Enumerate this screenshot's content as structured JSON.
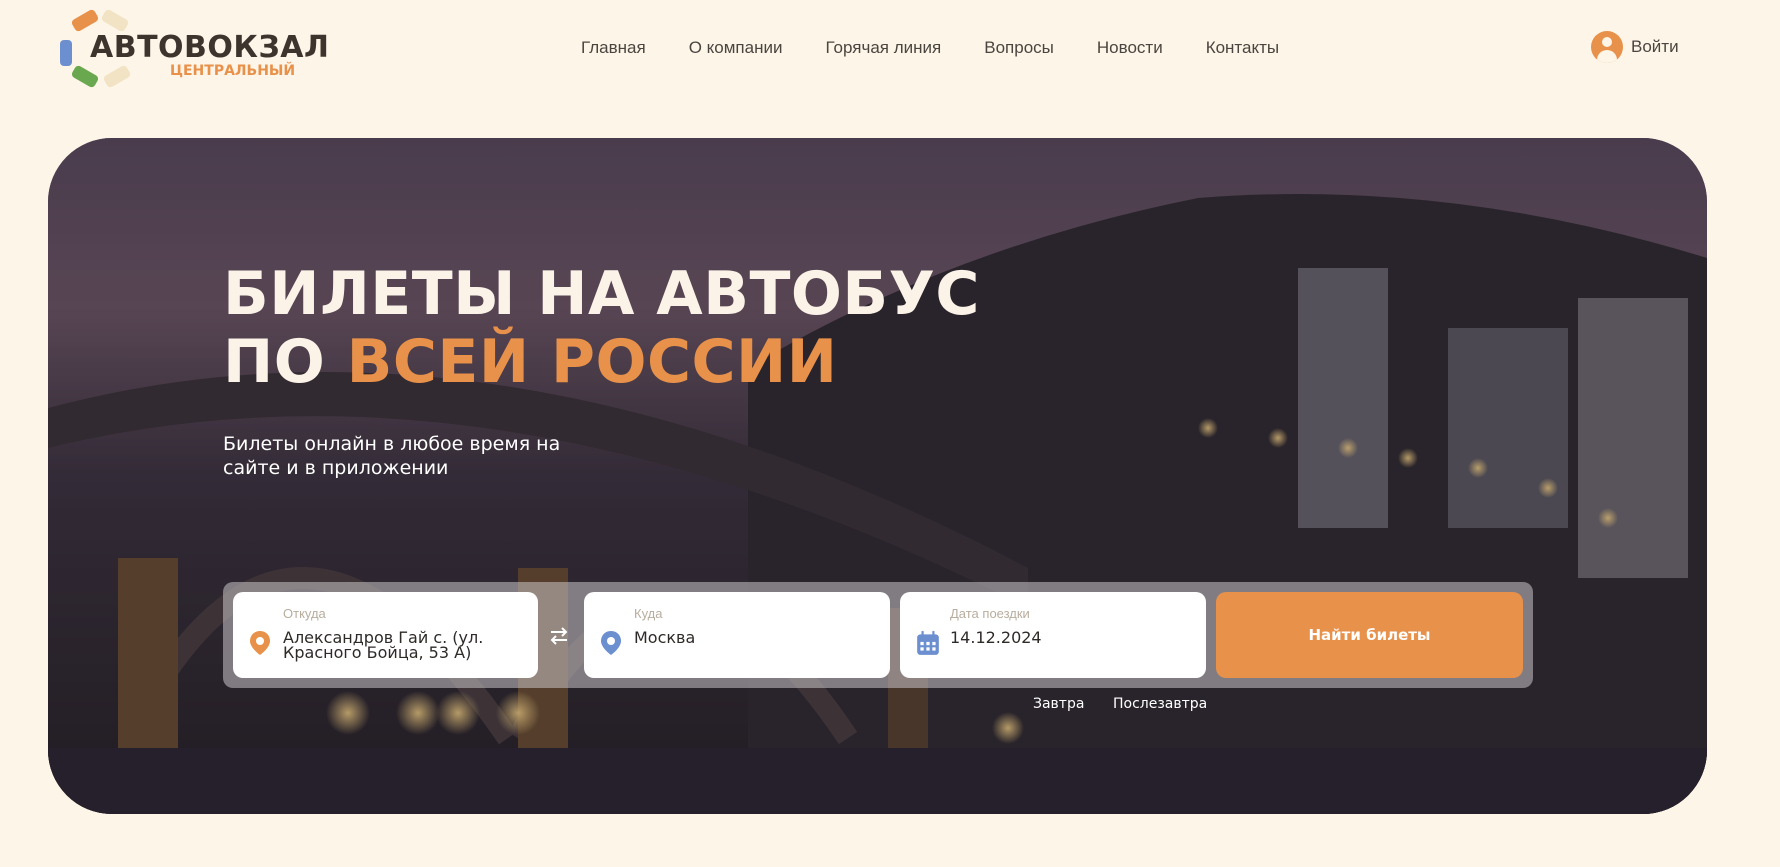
{
  "brand": {
    "name": "АВТОВОКЗАЛ",
    "subtitle": "ЦЕНТРАЛЬНЫЙ",
    "colors": {
      "orange": "#e8914a",
      "blue": "#6b8fcf",
      "green": "#6aa84f",
      "cream": "#f1e3c4"
    }
  },
  "nav": {
    "items": [
      "Главная",
      "О компании",
      "Горячая линия",
      "Вопросы",
      "Новости",
      "Контакты"
    ]
  },
  "login": {
    "label": "Войти",
    "icon": "user-icon"
  },
  "hero": {
    "title_line1": "БИЛЕТЫ НА АВТОБУС",
    "title_line2_prefix": "ПО ",
    "title_line2_accent": "ВСЕЙ РОССИИ",
    "subtitle": "Билеты онлайн в любое время на сайте и в приложении"
  },
  "search": {
    "from": {
      "label": "Откуда",
      "value": "Александров Гай с. (ул. Красного Бойца, 53 А)",
      "icon": "map-pin-icon"
    },
    "swap_icon": "swap-arrows-icon",
    "to": {
      "label": "Куда",
      "value": "Москва",
      "icon": "map-pin-icon"
    },
    "date": {
      "label": "Дата поездки",
      "value": "14.12.2024",
      "icon": "calendar-icon"
    },
    "submit_label": "Найти билеты",
    "quick_dates": [
      "Завтра",
      "Послезавтра"
    ]
  },
  "colors": {
    "page_bg": "#fdf5e7",
    "accent": "#e8914a",
    "text": "#3e342e"
  }
}
